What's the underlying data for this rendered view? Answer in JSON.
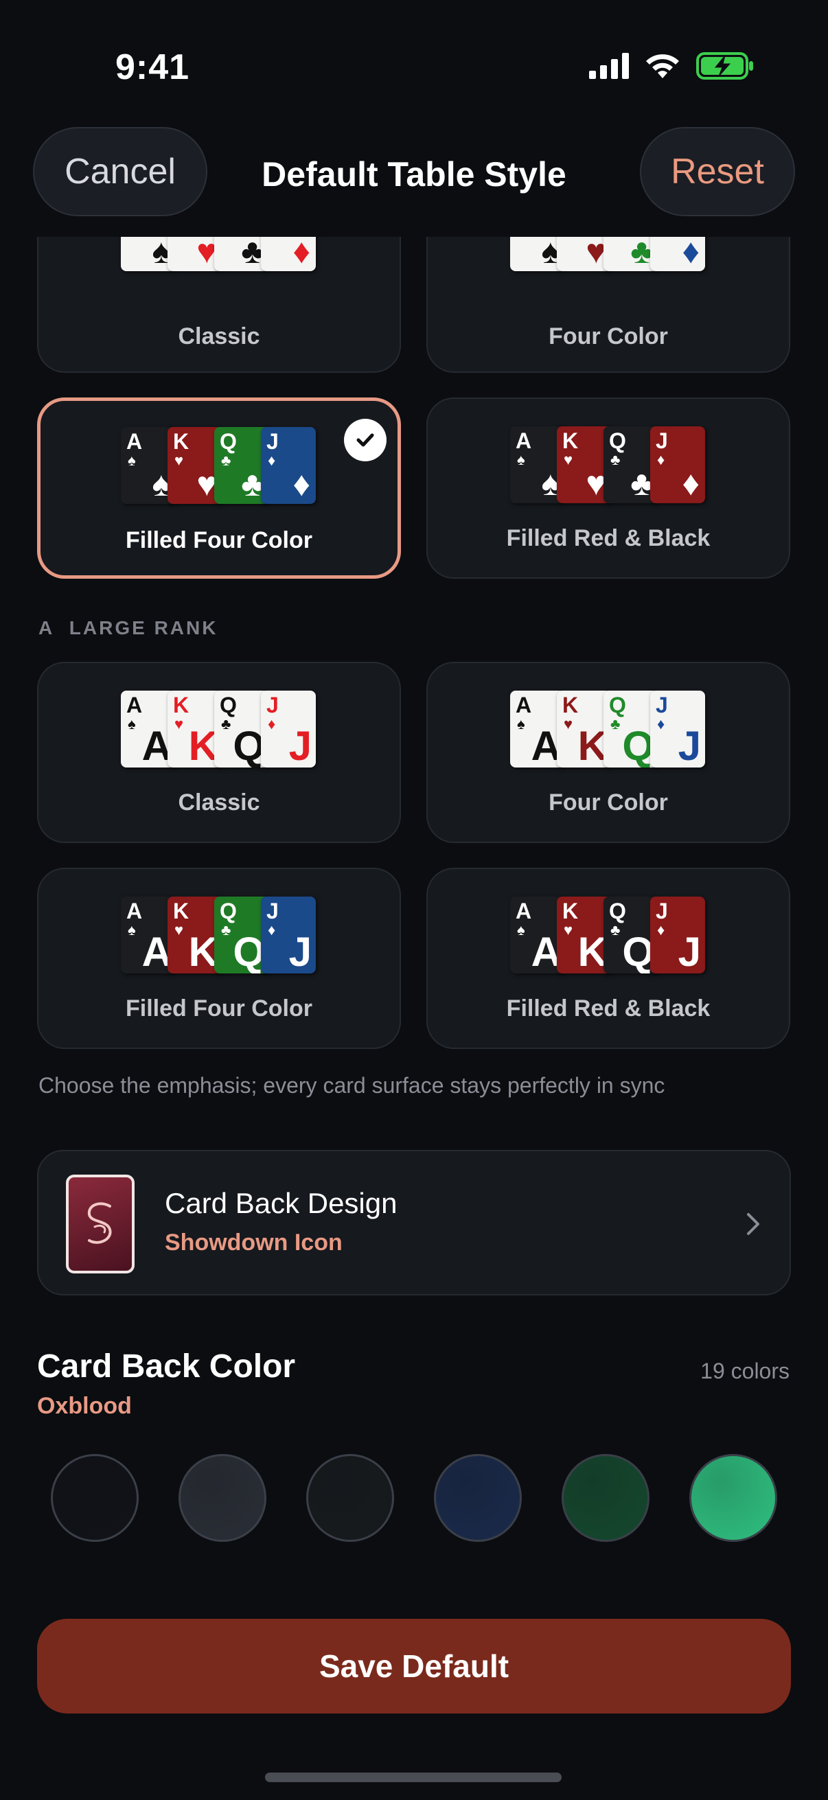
{
  "status": {
    "time": "9:41"
  },
  "nav": {
    "cancel": "Cancel",
    "title": "Default Table Style",
    "reset": "Reset"
  },
  "classic_section": {
    "tiles": [
      {
        "label": "Classic"
      },
      {
        "label": "Four Color"
      },
      {
        "label": "Filled Four Color",
        "selected": true
      },
      {
        "label": "Filled Red & Black"
      }
    ]
  },
  "large_rank_section": {
    "header_glyph": "A",
    "header": "LARGE RANK",
    "tiles": [
      {
        "label": "Classic"
      },
      {
        "label": "Four Color"
      },
      {
        "label": "Filled Four Color"
      },
      {
        "label": "Filled Red & Black"
      }
    ]
  },
  "cards": {
    "ranks": [
      "A",
      "K",
      "Q",
      "J"
    ],
    "suits": [
      "♠",
      "♥",
      "♣",
      "♦"
    ]
  },
  "hint": "Choose the emphasis; every card surface stays perfectly in sync",
  "card_back_design": {
    "title": "Card Back Design",
    "subtitle": "Showdown Icon"
  },
  "card_back_color": {
    "title": "Card Back Color",
    "count": "19 colors",
    "selected_name": "Oxblood",
    "swatches": [
      "#111319",
      "#2a2e36",
      "#171b1e",
      "#1a2a4a",
      "#15482e",
      "#2fbf7f"
    ]
  },
  "save_button": "Save Default",
  "colors": {
    "accent": "#e89a84",
    "save_bg": "#7a2a1c",
    "suit_black": "#111111",
    "suit_red": "#e31e24",
    "suit_dark_red": "#8b1a1a",
    "suit_green": "#1f8a2a",
    "suit_blue": "#1b4a9a"
  }
}
